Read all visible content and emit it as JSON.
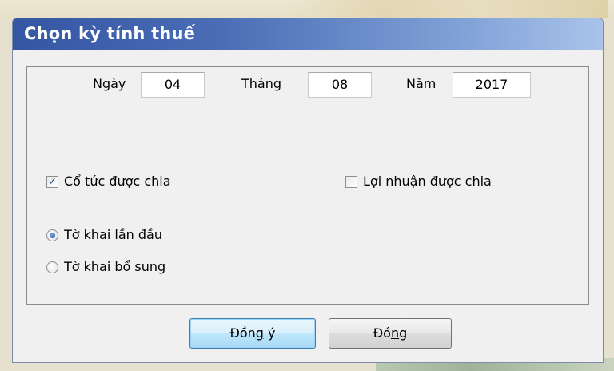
{
  "dialog": {
    "title": "Chọn kỳ tính thuế"
  },
  "date": {
    "day_label": "Ngày",
    "day_value": "04",
    "month_label": "Tháng",
    "month_value": "08",
    "year_label": "Năm",
    "year_value": "2017"
  },
  "options": {
    "dividends_label": "Cổ tức được chia",
    "dividends_checked": true,
    "profit_label": "Lợi nhuận được chia",
    "profit_checked": false
  },
  "declaration_type": {
    "first_label": "Tờ khai lần đầu",
    "supplement_label": "Tờ khai bổ sung",
    "selected": "first"
  },
  "buttons": {
    "ok_prefix": "Đồn",
    "ok_mnemonic": "g",
    "ok_suffix": " ý",
    "close_prefix": "Đó",
    "close_mnemonic": "n",
    "close_suffix": "g"
  }
}
